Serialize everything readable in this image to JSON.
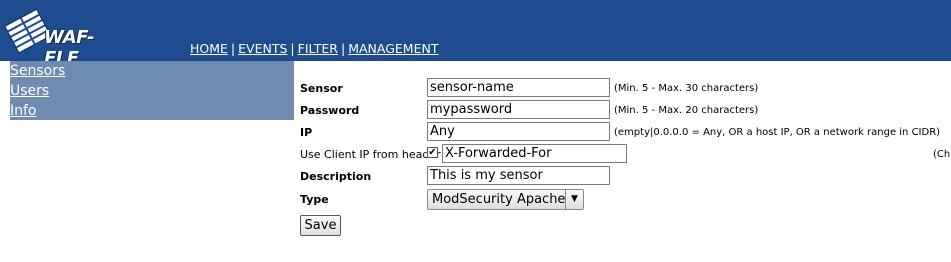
{
  "header": {
    "logo_text": "WAF-FLE",
    "nav": [
      {
        "label": "HOME"
      },
      {
        "label": "EVENTS"
      },
      {
        "label": "FILTER"
      },
      {
        "label": "MANAGEMENT"
      }
    ],
    "separator": "|"
  },
  "sidebar": {
    "items": [
      {
        "label": "Sensors"
      },
      {
        "label": "Users"
      },
      {
        "label": "Info"
      }
    ]
  },
  "form": {
    "sensor": {
      "label": "Sensor",
      "value": "sensor-name",
      "hint": "(Min. 5 - Max. 30 characters)"
    },
    "password": {
      "label": "Password",
      "value": "mypassword",
      "hint": "(Min. 5 - Max. 20 characters)"
    },
    "ip": {
      "label": "IP",
      "value": "Any",
      "hint": "(empty|0.0.0.0 = Any, OR a host IP, OR a network range in CIDR)"
    },
    "client_ip": {
      "label": "Use Client IP from header",
      "checked_mark": "✔",
      "value": "X-Forwarded-For",
      "hint_clipped": "(Ch"
    },
    "description": {
      "label": "Description",
      "value": "This is my sensor"
    },
    "type": {
      "label": "Type",
      "selected": "ModSecurity Apache"
    },
    "save_label": "Save"
  },
  "colors": {
    "header_bg": "#1f4c8e",
    "sidebar_bg": "#6f8bb1"
  }
}
